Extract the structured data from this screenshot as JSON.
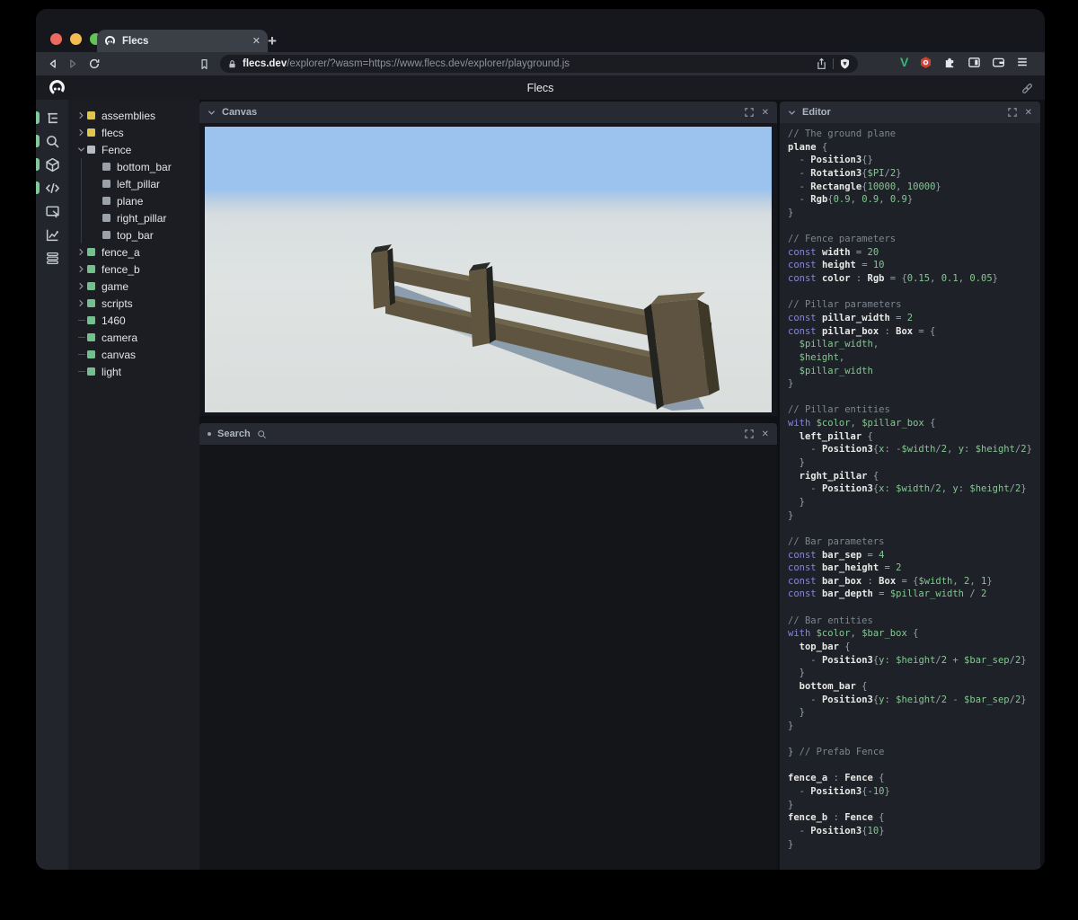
{
  "browser": {
    "traffic_lights": [
      "#ee6a5f",
      "#f5bd4f",
      "#61c454"
    ],
    "tab": {
      "title": "Flecs",
      "close_label": "✕"
    },
    "new_tab_label": "+",
    "url_host": "flecs.dev",
    "url_rest": "/explorer/?wasm=https://www.flecs.dev/explorer/playground.js"
  },
  "header": {
    "title": "Flecs"
  },
  "sidebar": {
    "icons": [
      {
        "name": "tree-icon",
        "active": true
      },
      {
        "name": "search-icon",
        "active": true
      },
      {
        "name": "cube-icon",
        "active": true
      },
      {
        "name": "code-icon",
        "active": true
      },
      {
        "name": "inspector-icon",
        "active": false
      },
      {
        "name": "chart-icon",
        "active": false
      },
      {
        "name": "logs-icon",
        "active": false
      }
    ]
  },
  "tree": {
    "items": [
      {
        "label": "assemblies",
        "dot": "#dfc54d",
        "arrow": "collapsed",
        "depth": 0
      },
      {
        "label": "flecs",
        "dot": "#dfc54d",
        "arrow": "collapsed",
        "depth": 0
      },
      {
        "label": "Fence",
        "dot": "#b6bcc3",
        "arrow": "expanded",
        "depth": 0
      },
      {
        "label": "bottom_bar",
        "dot": "#9aa1a8",
        "arrow": "none",
        "depth": 1
      },
      {
        "label": "left_pillar",
        "dot": "#9aa1a8",
        "arrow": "none",
        "depth": 1
      },
      {
        "label": "plane",
        "dot": "#9aa1a8",
        "arrow": "none",
        "depth": 1
      },
      {
        "label": "right_pillar",
        "dot": "#9aa1a8",
        "arrow": "none",
        "depth": 1
      },
      {
        "label": "top_bar",
        "dot": "#9aa1a8",
        "arrow": "none",
        "depth": 1
      },
      {
        "label": "fence_a",
        "dot": "#74c08d",
        "arrow": "collapsed",
        "depth": 0
      },
      {
        "label": "fence_b",
        "dot": "#74c08d",
        "arrow": "collapsed",
        "depth": 0
      },
      {
        "label": "game",
        "dot": "#74c08d",
        "arrow": "collapsed",
        "depth": 0
      },
      {
        "label": "scripts",
        "dot": "#74c08d",
        "arrow": "collapsed",
        "depth": 0
      },
      {
        "label": "1460",
        "dot": "#74c08d",
        "arrow": "leaf",
        "depth": 0
      },
      {
        "label": "camera",
        "dot": "#74c08d",
        "arrow": "leaf",
        "depth": 0
      },
      {
        "label": "canvas",
        "dot": "#74c08d",
        "arrow": "leaf",
        "depth": 0
      },
      {
        "label": "light",
        "dot": "#74c08d",
        "arrow": "leaf",
        "depth": 0
      }
    ]
  },
  "panels": {
    "canvas": {
      "title": "Canvas"
    },
    "search": {
      "title": "Search"
    },
    "editor": {
      "title": "Editor"
    }
  },
  "scene": {
    "sky": "#9cc3ee",
    "ground": "#dfe3e2",
    "wood_front": "#5e5440",
    "wood_top": "#6e644c",
    "wood_dark": "#23241f",
    "wood_side": "#3e3829",
    "shadow": "#7e90a3"
  },
  "editor_code": {
    "lines": [
      [
        [
          "c",
          "// The ground plane"
        ]
      ],
      [
        [
          "b",
          "plane"
        ],
        [
          "p",
          " {"
        ]
      ],
      [
        [
          "p",
          "  - "
        ],
        [
          "b",
          "Position3"
        ],
        [
          "p",
          "{}"
        ]
      ],
      [
        [
          "p",
          "  - "
        ],
        [
          "b",
          "Rotation3"
        ],
        [
          "p",
          "{"
        ],
        [
          "g",
          "$PI"
        ],
        [
          "p",
          "/"
        ],
        [
          "g",
          "2"
        ],
        [
          "p",
          "}"
        ]
      ],
      [
        [
          "p",
          "  - "
        ],
        [
          "b",
          "Rectangle"
        ],
        [
          "p",
          "{"
        ],
        [
          "g",
          "10000"
        ],
        [
          "p",
          ", "
        ],
        [
          "g",
          "10000"
        ],
        [
          "p",
          "}"
        ]
      ],
      [
        [
          "p",
          "  - "
        ],
        [
          "b",
          "Rgb"
        ],
        [
          "p",
          "{"
        ],
        [
          "g",
          "0.9"
        ],
        [
          "p",
          ", "
        ],
        [
          "g",
          "0.9"
        ],
        [
          "p",
          ", "
        ],
        [
          "g",
          "0.9"
        ],
        [
          "p",
          "}"
        ]
      ],
      [
        [
          "p",
          "}"
        ]
      ],
      [],
      [
        [
          "c",
          "// Fence parameters"
        ]
      ],
      [
        [
          "k",
          "const "
        ],
        [
          "b",
          "width"
        ],
        [
          "p",
          " = "
        ],
        [
          "g",
          "20"
        ]
      ],
      [
        [
          "k",
          "const "
        ],
        [
          "b",
          "height"
        ],
        [
          "p",
          " = "
        ],
        [
          "g",
          "10"
        ]
      ],
      [
        [
          "k",
          "const "
        ],
        [
          "b",
          "color"
        ],
        [
          "p",
          " : "
        ],
        [
          "b",
          "Rgb"
        ],
        [
          "p",
          " = {"
        ],
        [
          "g",
          "0.15"
        ],
        [
          "p",
          ", "
        ],
        [
          "g",
          "0.1"
        ],
        [
          "p",
          ", "
        ],
        [
          "g",
          "0.05"
        ],
        [
          "p",
          "}"
        ]
      ],
      [],
      [
        [
          "c",
          "// Pillar parameters"
        ]
      ],
      [
        [
          "k",
          "const "
        ],
        [
          "b",
          "pillar_width"
        ],
        [
          "p",
          " = "
        ],
        [
          "g",
          "2"
        ]
      ],
      [
        [
          "k",
          "const "
        ],
        [
          "b",
          "pillar_box"
        ],
        [
          "p",
          " : "
        ],
        [
          "b",
          "Box"
        ],
        [
          "p",
          " = {"
        ]
      ],
      [
        [
          "g",
          "  $pillar_width"
        ],
        [
          "p",
          ","
        ]
      ],
      [
        [
          "g",
          "  $height"
        ],
        [
          "p",
          ","
        ]
      ],
      [
        [
          "g",
          "  $pillar_width"
        ]
      ],
      [
        [
          "p",
          "}"
        ]
      ],
      [],
      [
        [
          "c",
          "// Pillar entities"
        ]
      ],
      [
        [
          "k",
          "with "
        ],
        [
          "g",
          "$color"
        ],
        [
          "p",
          ", "
        ],
        [
          "g",
          "$pillar_box"
        ],
        [
          "p",
          " {"
        ]
      ],
      [
        [
          "b",
          "  left_pillar"
        ],
        [
          "p",
          " {"
        ]
      ],
      [
        [
          "p",
          "    - "
        ],
        [
          "b",
          "Position3"
        ],
        [
          "p",
          "{"
        ],
        [
          "g",
          "x"
        ],
        [
          "p",
          ": -"
        ],
        [
          "g",
          "$width"
        ],
        [
          "p",
          "/"
        ],
        [
          "g",
          "2"
        ],
        [
          "p",
          ", "
        ],
        [
          "g",
          "y"
        ],
        [
          "p",
          ": "
        ],
        [
          "g",
          "$height"
        ],
        [
          "p",
          "/"
        ],
        [
          "g",
          "2"
        ],
        [
          "p",
          "}"
        ]
      ],
      [
        [
          "p",
          "  }"
        ]
      ],
      [
        [
          "b",
          "  right_pillar"
        ],
        [
          "p",
          " {"
        ]
      ],
      [
        [
          "p",
          "    - "
        ],
        [
          "b",
          "Position3"
        ],
        [
          "p",
          "{"
        ],
        [
          "g",
          "x"
        ],
        [
          "p",
          ": "
        ],
        [
          "g",
          "$width"
        ],
        [
          "p",
          "/"
        ],
        [
          "g",
          "2"
        ],
        [
          "p",
          ", "
        ],
        [
          "g",
          "y"
        ],
        [
          "p",
          ": "
        ],
        [
          "g",
          "$height"
        ],
        [
          "p",
          "/"
        ],
        [
          "g",
          "2"
        ],
        [
          "p",
          "}"
        ]
      ],
      [
        [
          "p",
          "  }"
        ]
      ],
      [
        [
          "p",
          "}"
        ]
      ],
      [],
      [
        [
          "c",
          "// Bar parameters"
        ]
      ],
      [
        [
          "k",
          "const "
        ],
        [
          "b",
          "bar_sep"
        ],
        [
          "p",
          " = "
        ],
        [
          "g",
          "4"
        ]
      ],
      [
        [
          "k",
          "const "
        ],
        [
          "b",
          "bar_height"
        ],
        [
          "p",
          " = "
        ],
        [
          "g",
          "2"
        ]
      ],
      [
        [
          "k",
          "const "
        ],
        [
          "b",
          "bar_box"
        ],
        [
          "p",
          " : "
        ],
        [
          "b",
          "Box"
        ],
        [
          "p",
          " = {"
        ],
        [
          "g",
          "$width"
        ],
        [
          "p",
          ", "
        ],
        [
          "g",
          "2"
        ],
        [
          "p",
          ", "
        ],
        [
          "g",
          "1"
        ],
        [
          "p",
          "}"
        ]
      ],
      [
        [
          "k",
          "const "
        ],
        [
          "b",
          "bar_depth"
        ],
        [
          "p",
          " = "
        ],
        [
          "g",
          "$pillar_width"
        ],
        [
          "p",
          " / "
        ],
        [
          "g",
          "2"
        ]
      ],
      [],
      [
        [
          "c",
          "// Bar entities"
        ]
      ],
      [
        [
          "k",
          "with "
        ],
        [
          "g",
          "$color"
        ],
        [
          "p",
          ", "
        ],
        [
          "g",
          "$bar_box"
        ],
        [
          "p",
          " {"
        ]
      ],
      [
        [
          "b",
          "  top_bar"
        ],
        [
          "p",
          " {"
        ]
      ],
      [
        [
          "p",
          "    - "
        ],
        [
          "b",
          "Position3"
        ],
        [
          "p",
          "{"
        ],
        [
          "g",
          "y"
        ],
        [
          "p",
          ": "
        ],
        [
          "g",
          "$height"
        ],
        [
          "p",
          "/"
        ],
        [
          "g",
          "2"
        ],
        [
          "p",
          " + "
        ],
        [
          "g",
          "$bar_sep"
        ],
        [
          "p",
          "/"
        ],
        [
          "g",
          "2"
        ],
        [
          "p",
          "}"
        ]
      ],
      [
        [
          "p",
          "  }"
        ]
      ],
      [
        [
          "b",
          "  bottom_bar"
        ],
        [
          "p",
          " {"
        ]
      ],
      [
        [
          "p",
          "    - "
        ],
        [
          "b",
          "Position3"
        ],
        [
          "p",
          "{"
        ],
        [
          "g",
          "y"
        ],
        [
          "p",
          ": "
        ],
        [
          "g",
          "$height"
        ],
        [
          "p",
          "/"
        ],
        [
          "g",
          "2"
        ],
        [
          "p",
          " - "
        ],
        [
          "g",
          "$bar_sep"
        ],
        [
          "p",
          "/"
        ],
        [
          "g",
          "2"
        ],
        [
          "p",
          "}"
        ]
      ],
      [
        [
          "p",
          "  }"
        ]
      ],
      [
        [
          "p",
          "}"
        ]
      ],
      [],
      [
        [
          "p",
          "} "
        ],
        [
          "c",
          "// Prefab Fence"
        ]
      ],
      [],
      [
        [
          "b",
          "fence_a"
        ],
        [
          "p",
          " : "
        ],
        [
          "b",
          "Fence"
        ],
        [
          "p",
          " {"
        ]
      ],
      [
        [
          "p",
          "  - "
        ],
        [
          "b",
          "Position3"
        ],
        [
          "p",
          "{"
        ],
        [
          "g",
          "-10"
        ],
        [
          "p",
          "}"
        ]
      ],
      [
        [
          "p",
          "}"
        ]
      ],
      [
        [
          "b",
          "fence_b"
        ],
        [
          "p",
          " : "
        ],
        [
          "b",
          "Fence"
        ],
        [
          "p",
          " {"
        ]
      ],
      [
        [
          "p",
          "  - "
        ],
        [
          "b",
          "Position3"
        ],
        [
          "p",
          "{"
        ],
        [
          "g",
          "10"
        ],
        [
          "p",
          "}"
        ]
      ],
      [
        [
          "p",
          "}"
        ]
      ]
    ]
  }
}
